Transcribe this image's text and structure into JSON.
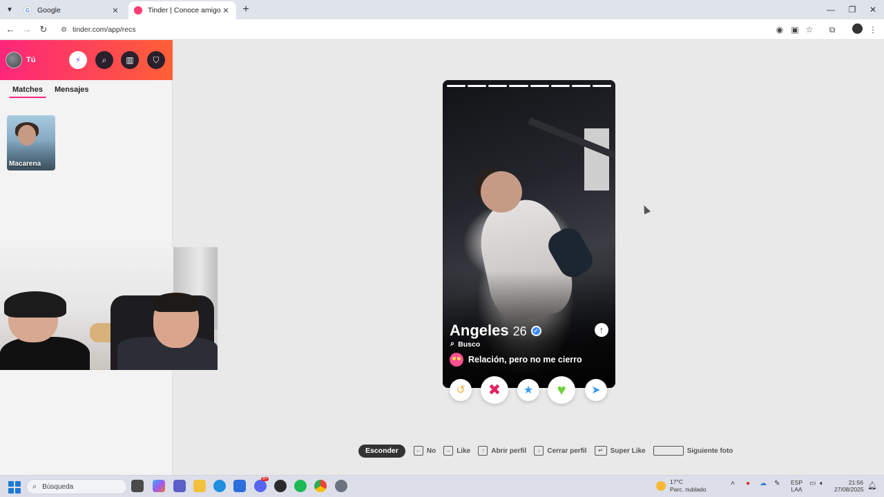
{
  "browser": {
    "tabs": [
      {
        "title": "Google",
        "active": false
      },
      {
        "title": "Tinder | Conoce amigos y gente",
        "active": true
      }
    ],
    "url": "tinder.com/app/recs"
  },
  "sidebar": {
    "user_label": "Tú",
    "tabs": [
      "Matches",
      "Mensajes"
    ],
    "matches": [
      {
        "name": "Macarena"
      }
    ]
  },
  "profile": {
    "name": "Angeles",
    "age": "26",
    "looking_for_label": "Busco",
    "relationship_goal": "Relación, pero no me cierro",
    "photo_count": 8,
    "current_photo": 8
  },
  "actions": [
    "rewind",
    "nope",
    "super-like",
    "like",
    "boost"
  ],
  "keyboard_hints": {
    "hide": "Esconder",
    "no": "No",
    "like": "Like",
    "open_profile": "Abrir perfil",
    "close_profile": "Cerrar perfil",
    "super_like": "Super Like",
    "next_photo": "Siguiente foto"
  },
  "taskbar": {
    "search_placeholder": "Búsqueda",
    "weather_temp": "17°C",
    "weather_desc": "Parc. nublado",
    "lang_1": "ESP",
    "lang_2": "LAA",
    "time": "21:56",
    "date": "27/08/2025",
    "discord_badge": "9+"
  },
  "colors": {
    "brand_gradient_start": "#fd267a",
    "brand_gradient_end": "#ff6036",
    "nope": "#e0245e",
    "super_like": "#3d9be9",
    "like": "#6fd33b",
    "boost": "#3d9be9",
    "rewind": "#f5b13d"
  }
}
